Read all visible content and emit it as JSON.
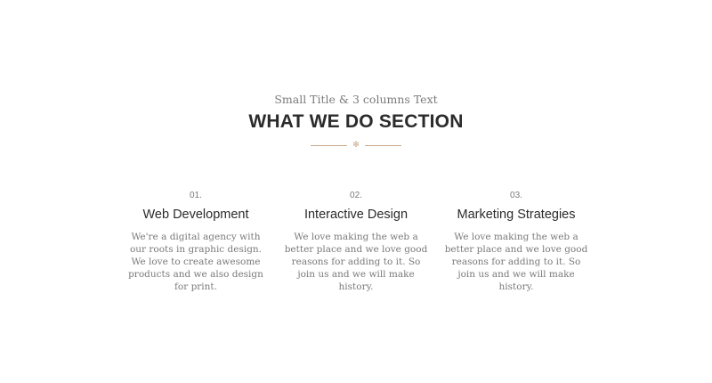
{
  "header": {
    "subtitle": "Small Title & 3 columns Text",
    "title": "WHAT WE DO SECTION",
    "divider_icon": "✻"
  },
  "colors": {
    "accent": "#c9a98c",
    "heading": "#2b2b2b",
    "body": "#7a7a7a"
  },
  "columns": [
    {
      "number": "01.",
      "title": "Web Development",
      "text": "We're a digital agency with our roots in graphic design. We love to create awesome products and we also design for print."
    },
    {
      "number": "02.",
      "title": "Interactive Design",
      "text": "We love making the web a better place and we love good reasons for adding to it. So join us and we will make history."
    },
    {
      "number": "03.",
      "title": "Marketing Strategies",
      "text": "We love making the web a better place and we love good reasons for adding to it. So join us and we will make history."
    }
  ]
}
